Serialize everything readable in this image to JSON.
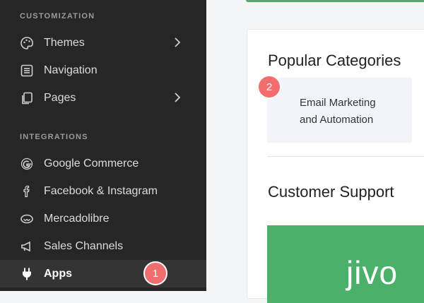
{
  "sidebar": {
    "customization_label": "CUSTOMIZATION",
    "integrations_label": "INTEGRATIONS",
    "items": [
      {
        "label": "Themes"
      },
      {
        "label": "Navigation"
      },
      {
        "label": "Pages"
      },
      {
        "label": "Google Commerce"
      },
      {
        "label": "Facebook & Instagram"
      },
      {
        "label": "Mercadolibre"
      },
      {
        "label": "Sales Channels"
      },
      {
        "label": "Apps"
      }
    ]
  },
  "badges": {
    "first": "1",
    "second": "2"
  },
  "main": {
    "popular_title": "Popular Categories",
    "category_line1": "Email Marketing",
    "category_line2": "and Automation",
    "support_title": "Customer Support",
    "support_logo_text": "jivo"
  },
  "colors": {
    "sidebar_bg": "#262626",
    "badge": "#f26d6d",
    "support_green": "#4bb06a",
    "category_tile": "#f1f5fa"
  }
}
